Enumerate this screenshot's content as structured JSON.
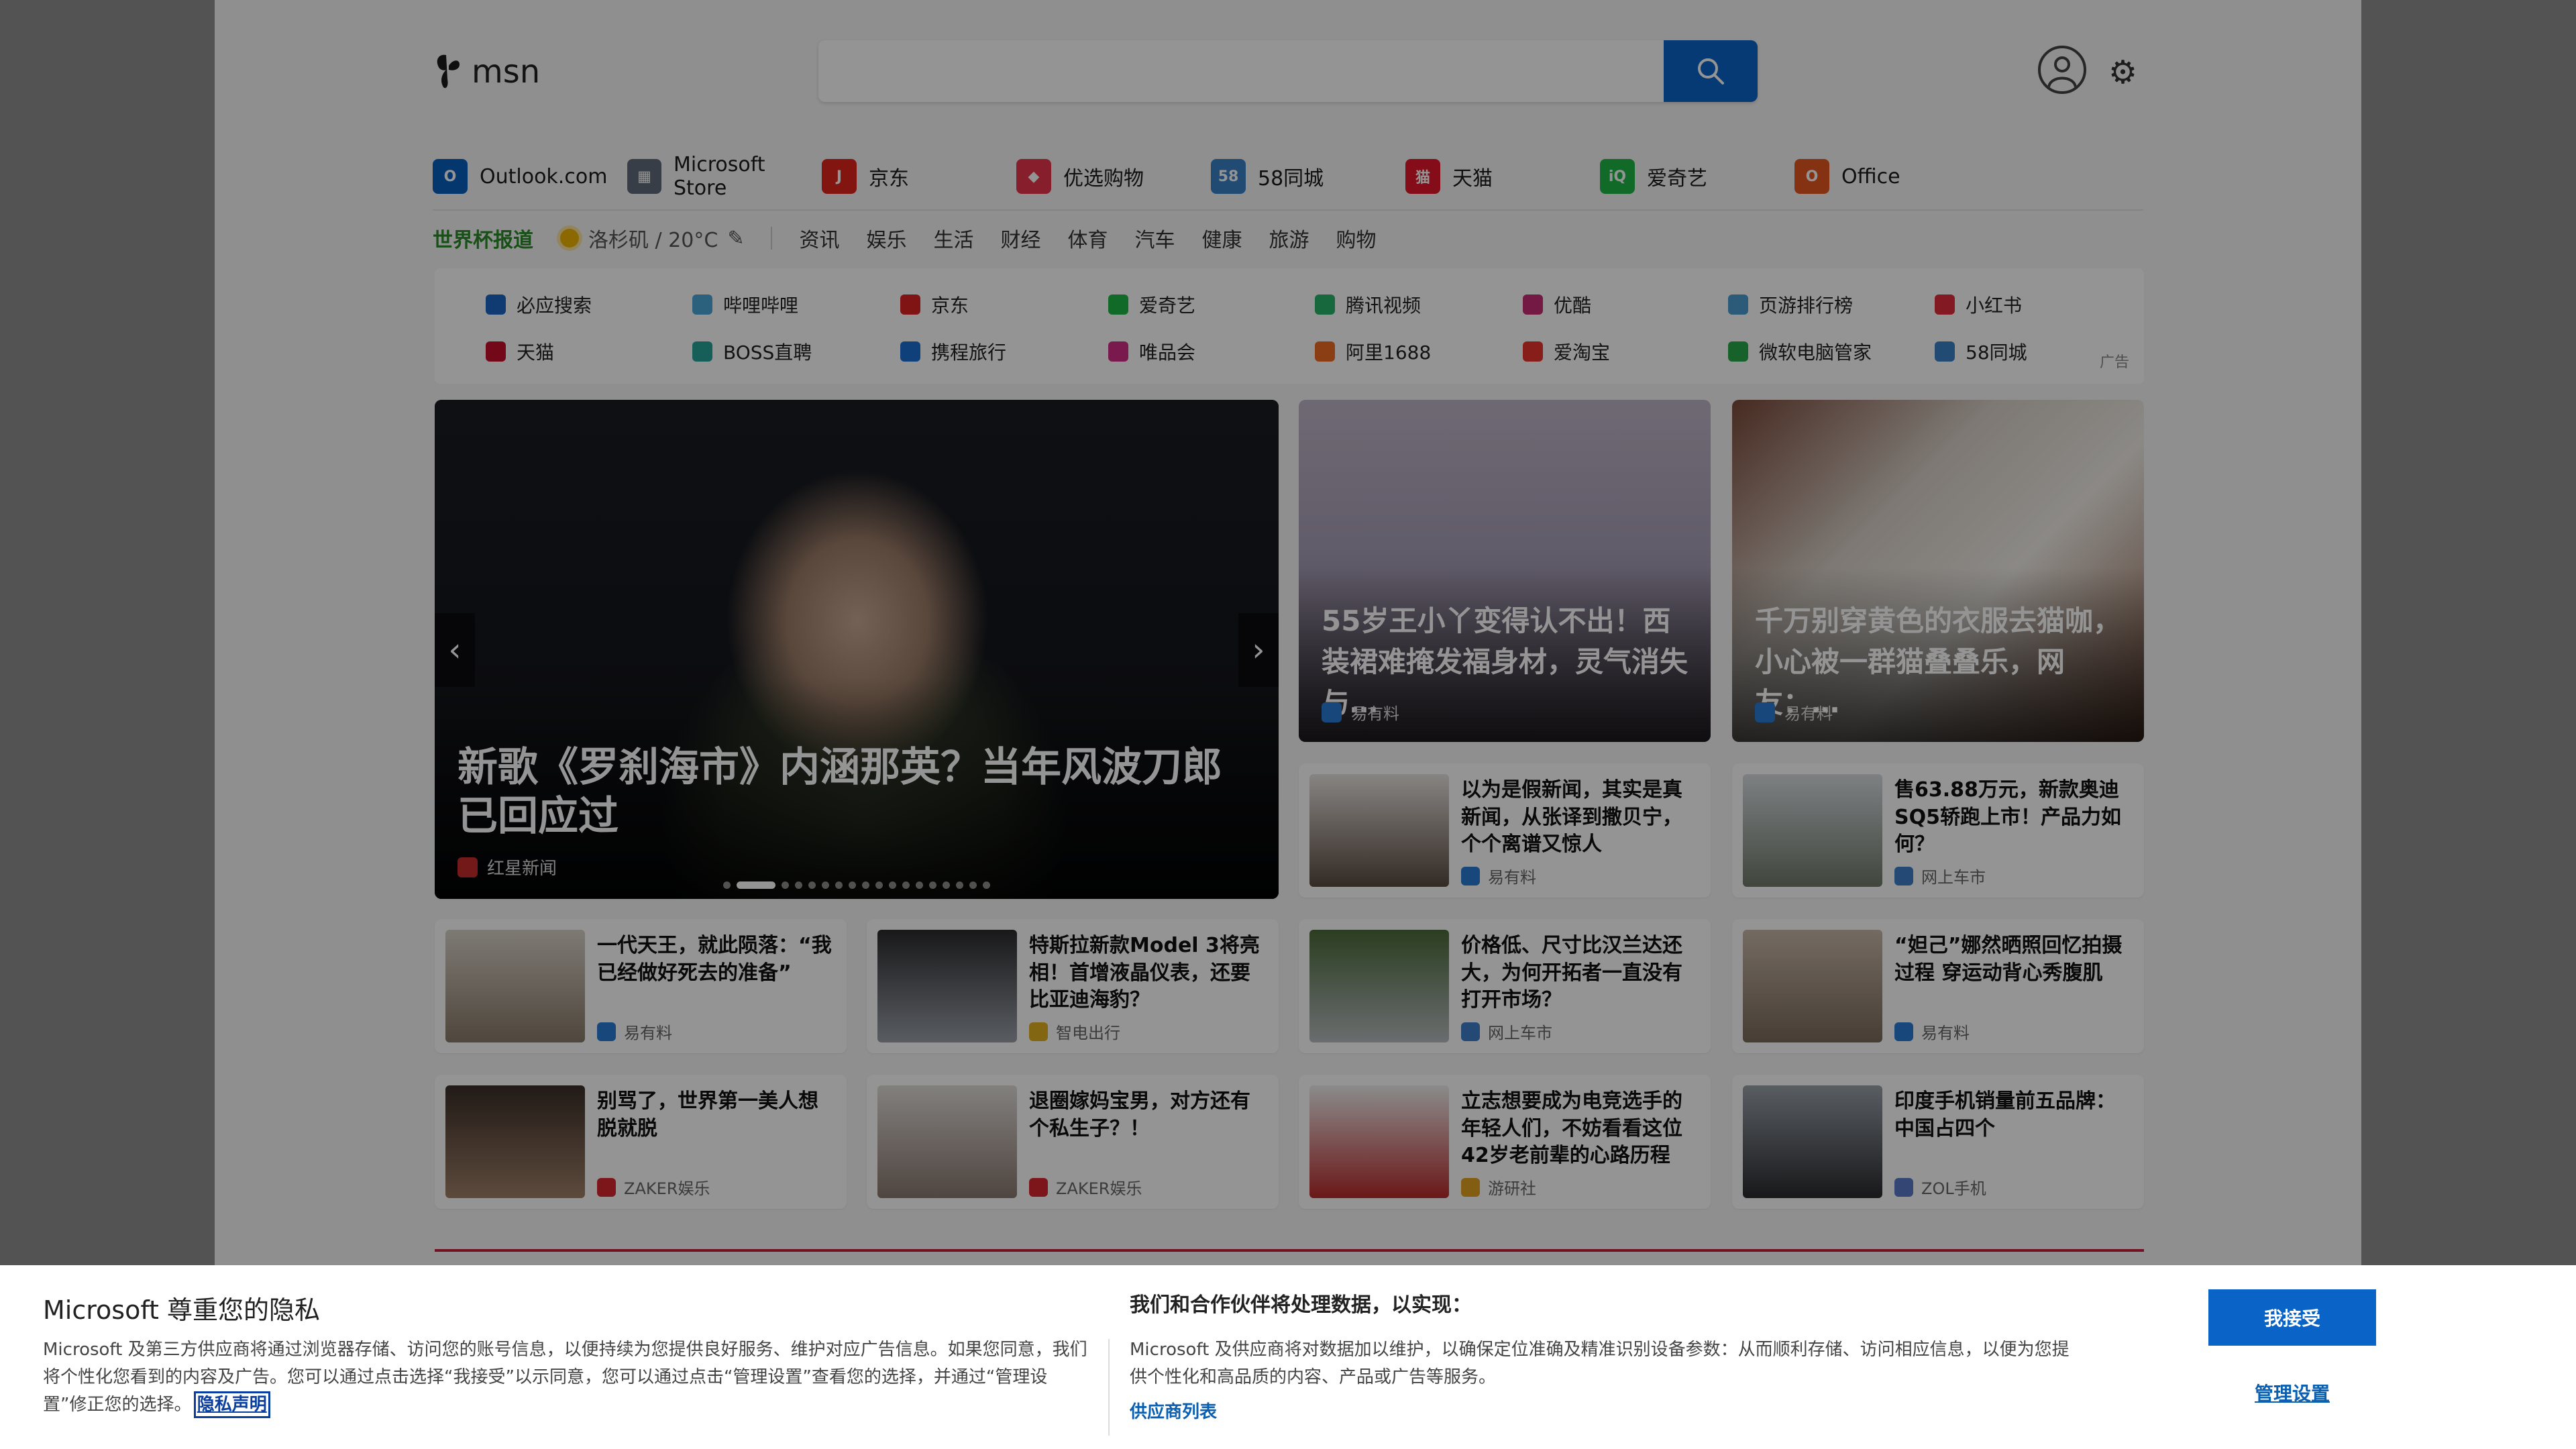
{
  "header": {
    "logo_text": "msn",
    "search_placeholder": ""
  },
  "apps": [
    {
      "label": "Outlook.com",
      "icon": "outlook-icon",
      "color": "#0a5fc0",
      "glyph": "O"
    },
    {
      "label": "Microsoft Store",
      "icon": "store-icon",
      "color": "#5f6b7a",
      "glyph": "▦"
    },
    {
      "label": "京东",
      "icon": "jd-icon",
      "color": "#e1251b",
      "glyph": "J"
    },
    {
      "label": "优选购物",
      "icon": "shopping-bag-icon",
      "color": "#e8344a",
      "glyph": "◆"
    },
    {
      "label": "58同城",
      "icon": "58-icon",
      "color": "#3b82c6",
      "glyph": "58"
    },
    {
      "label": "天猫",
      "icon": "tmall-icon",
      "color": "#e5182b",
      "glyph": "猫"
    },
    {
      "label": "爱奇艺",
      "icon": "iqiyi-icon",
      "color": "#1eb745",
      "glyph": "iQ"
    },
    {
      "label": "Office",
      "icon": "office-icon",
      "color": "#e3561f",
      "glyph": "O"
    }
  ],
  "nav": {
    "highlight": "世界杯报道",
    "weather": "洛杉矶 / 20°C",
    "items": [
      "资讯",
      "娱乐",
      "生活",
      "财经",
      "体育",
      "汽车",
      "健康",
      "旅游",
      "购物"
    ]
  },
  "quick_links": {
    "row1": [
      {
        "label": "必应搜索",
        "color": "#1a64c4"
      },
      {
        "label": "哔哩哔哩",
        "color": "#4aa8d8"
      },
      {
        "label": "京东",
        "color": "#d22"
      },
      {
        "label": "爱奇艺",
        "color": "#1eb745"
      },
      {
        "label": "腾讯视频",
        "color": "#2ab36b"
      },
      {
        "label": "优酷",
        "color": "#c62c74"
      },
      {
        "label": "页游排行榜",
        "color": "#4a9ed0"
      },
      {
        "label": "小红书",
        "color": "#e22b3b"
      }
    ],
    "row2": [
      {
        "label": "天猫",
        "color": "#c7102a"
      },
      {
        "label": "BOSS直聘",
        "color": "#27a49a"
      },
      {
        "label": "携程旅行",
        "color": "#1b6fd1"
      },
      {
        "label": "唯品会",
        "color": "#d12c86"
      },
      {
        "label": "阿里1688",
        "color": "#f06a22"
      },
      {
        "label": "爱淘宝",
        "color": "#e8352c"
      },
      {
        "label": "微软电脑管家",
        "color": "#28a84a"
      },
      {
        "label": "58同城",
        "color": "#3b82c6"
      }
    ],
    "ad_label": "广告"
  },
  "hero": {
    "title": "新歌《罗刹海市》内涵那英？当年风波刀郎已回应过",
    "source": "红星新闻",
    "source_color": "#c62b2b",
    "slide_count": 18,
    "active_slide": 1
  },
  "big_cards": [
    {
      "title": "55岁王小丫变得认不出！西装裙难掩发福身材，灵气消失与…",
      "source": "易有料",
      "bg": "linear-gradient(180deg,#bfb5c8 0%,#a89fb6 45%,#6a5f70 100%)"
    },
    {
      "title": "千万别穿黄色的衣服去猫咖，小心被一群猫叠叠乐，网友：…",
      "source": "易有料",
      "bg": "linear-gradient(135deg,#7a4a3a 0%,#d8d0c8 35%,#f0ece6 60%,#8a5a44 100%)"
    }
  ],
  "cards": [
    {
      "title": "以为是假新闻，其实是真新闻，从张译到撒贝宁，个个离谱又惊人",
      "source": "易有料",
      "src_color": "#2a7bd4",
      "thumb": "linear-gradient(180deg,#e8e4e0,#5a4a40)"
    },
    {
      "title": "售63.88万元，新款奥迪SQ5轿跑上市！产品力如何？",
      "source": "网上车市",
      "src_color": "#3d7fc8",
      "thumb": "linear-gradient(180deg,#d9dde2,#6f7a6a)"
    },
    {
      "title": "一代天王，就此陨落：“我已经做好死去的准备”",
      "source": "易有料",
      "src_color": "#2a7bd4",
      "thumb": "linear-gradient(180deg,#d8d2c8,#8a7a6a)"
    },
    {
      "title": "特斯拉新款Model 3将亮相！首增液晶仪表，还要比亚迪海豹？",
      "source": "智电出行",
      "src_color": "#e0b020",
      "thumb": "linear-gradient(180deg,#2b2b2e,#9aa0a8)"
    },
    {
      "title": "价格低、尺寸比汉兰达还大，为何开拓者一直没有打开市场？",
      "source": "网上车市",
      "src_color": "#3d7fc8",
      "thumb": "linear-gradient(180deg,#4a6a3a,#b8bcc0)"
    },
    {
      "title": "“妲己”娜然晒照回忆拍摄过程 穿运动背心秀腹肌",
      "source": "易有料",
      "src_color": "#2a7bd4",
      "thumb": "linear-gradient(180deg,#c8b8a8,#7a6a5a)"
    },
    {
      "title": "别骂了，世界第一美人想脱就脱",
      "source": "ZAKER娱乐",
      "src_color": "#d8262e",
      "thumb": "linear-gradient(180deg,#3a2e28,#a08068)"
    },
    {
      "title": "退圈嫁妈宝男，对方还有个私生子？！",
      "source": "ZAKER娱乐",
      "src_color": "#d8262e",
      "thumb": "linear-gradient(180deg,#e0dcd8,#8a7870)"
    },
    {
      "title": "立志想要成为电竞选手的年轻人们，不妨看看这位42岁老前辈的心路历程",
      "source": "游研社",
      "src_color": "#e0a020",
      "thumb": "linear-gradient(180deg,#f0f0f0,#b82a2a)"
    },
    {
      "title": "印度手机销量前五品牌：中国占四个",
      "source": "ZOL手机",
      "src_color": "#5a7ac8",
      "thumb": "linear-gradient(180deg,#9aa2aa,#2a2a2e)"
    }
  ],
  "privacy": {
    "title": "Microsoft 尊重您的隐私",
    "text": "Microsoft 及第三方供应商将通过浏览器存储、访问您的账号信息，以便持续为您提供良好服务、维护对应广告信息。如果您同意，我们将个性化您看到的内容及广告。您可以通过点击选择“我接受”以示同意，您可以通过点击“管理设置”查看您的选择，并通过“管理设置”修正您的选择。",
    "link": "隐私声明",
    "heading2": "我们和合作伙伴将处理数据，以实现：",
    "text2": "Microsoft 及供应商将对数据加以维护，以确保定位准确及精准识别设备参数：从而顺利存储、访问相应信息，以便为您提供个性化和高品质的内容、产品或广告等服务。",
    "vendor_list": "供应商列表",
    "accept": "我接受",
    "manage": "管理设置"
  }
}
